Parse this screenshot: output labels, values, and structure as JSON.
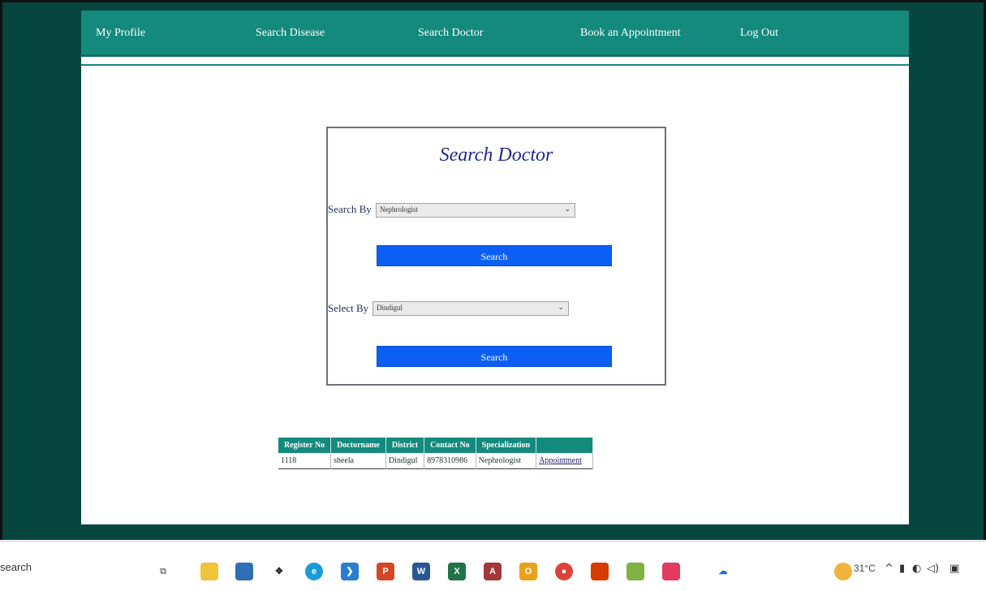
{
  "nav": {
    "items": [
      {
        "label": "My Profile"
      },
      {
        "label": "Search Disease"
      },
      {
        "label": "Search Doctor"
      },
      {
        "label": "Book an Appointment"
      },
      {
        "label": "Log Out"
      }
    ]
  },
  "panel": {
    "title": "Search Doctor",
    "search_by_label": "Search By",
    "search_by_value": "Nephrologist",
    "search_button_1": "Search",
    "select_by_label": "Select By",
    "select_by_value": "Dindigul",
    "search_button_2": "Search"
  },
  "results": {
    "headers": [
      "Register No",
      "Doctorname",
      "District",
      "Contact No",
      "Specialization",
      ""
    ],
    "rows": [
      {
        "register_no": "1118",
        "doctorname": "sheela",
        "district": "Dindigul",
        "contact_no": "8978310986",
        "specialization": "Nephrologist",
        "action": "Appointment"
      }
    ]
  },
  "taskbar": {
    "search_text": "search",
    "temperature": "31°C",
    "icons": [
      "task-view-icon",
      "file-explorer-icon",
      "store-icon",
      "dropbox-icon",
      "edge-icon",
      "vscode-icon",
      "powerpoint-icon",
      "word-icon",
      "excel-icon",
      "access-icon",
      "outlook-icon",
      "chrome-icon",
      "office-icon",
      "app-icon",
      "app-icon-2",
      "onedrive-icon",
      "weather-icon"
    ]
  },
  "colors": {
    "desktop": "#07453f",
    "navbar": "#138a7c",
    "button": "#0b5ff5",
    "title": "#1e2a8a"
  }
}
